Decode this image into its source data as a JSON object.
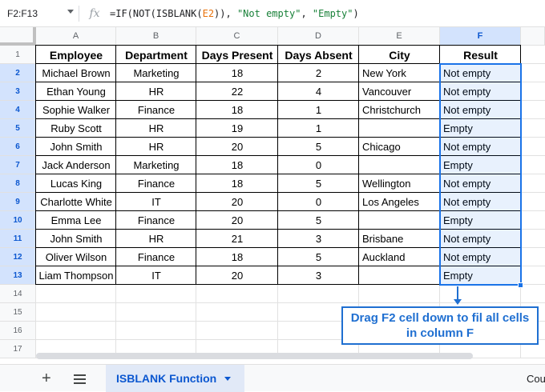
{
  "namebox": "F2:F13",
  "formula": {
    "prefix": "=IF(NOT(ISBLANK(",
    "ref": "E2",
    "middle": ")), ",
    "str1": "\"Not empty\"",
    "comma": ", ",
    "str2": "\"Empty\"",
    "suffix": ")"
  },
  "columns": [
    "A",
    "B",
    "C",
    "D",
    "E",
    "F"
  ],
  "selected_column": "F",
  "row_numbers": [
    "1",
    "2",
    "3",
    "4",
    "5",
    "6",
    "7",
    "8",
    "9",
    "10",
    "11",
    "12",
    "13",
    "14",
    "15",
    "16",
    "17"
  ],
  "headers": [
    "Employee",
    "Department",
    "Days Present",
    "Days Absent",
    "City",
    "Result"
  ],
  "rows": [
    [
      "Michael Brown",
      "Marketing",
      "18",
      "2",
      "New York",
      "Not empty"
    ],
    [
      "Ethan Young",
      "HR",
      "22",
      "4",
      "Vancouver",
      "Not empty"
    ],
    [
      "Sophie Walker",
      "Finance",
      "18",
      "1",
      "Christchurch",
      "Not empty"
    ],
    [
      "Ruby Scott",
      "HR",
      "19",
      "1",
      "",
      "Empty"
    ],
    [
      "John Smith",
      "HR",
      "20",
      "5",
      "Chicago",
      "Not empty"
    ],
    [
      "Jack Anderson",
      "Marketing",
      "18",
      "0",
      "",
      "Empty"
    ],
    [
      "Lucas King",
      "Finance",
      "18",
      "5",
      "Wellington",
      "Not empty"
    ],
    [
      "Charlotte White",
      "IT",
      "20",
      "0",
      "Los Angeles",
      "Not empty"
    ],
    [
      "Emma Lee",
      "Finance",
      "20",
      "5",
      "",
      "Empty"
    ],
    [
      "John Smith",
      "HR",
      "21",
      "3",
      "Brisbane",
      "Not empty"
    ],
    [
      "Oliver Wilson",
      "Finance",
      "18",
      "5",
      "Auckland",
      "Not empty"
    ],
    [
      "Liam Thompson",
      "IT",
      "20",
      "3",
      "",
      "Empty"
    ]
  ],
  "annotation": {
    "line1": "Drag F2 cell down to fil all cells",
    "line2": "in column F"
  },
  "sheet_tab": "ISBLANK Function",
  "status_count": "Cou",
  "accent_color": "#1a73e8"
}
